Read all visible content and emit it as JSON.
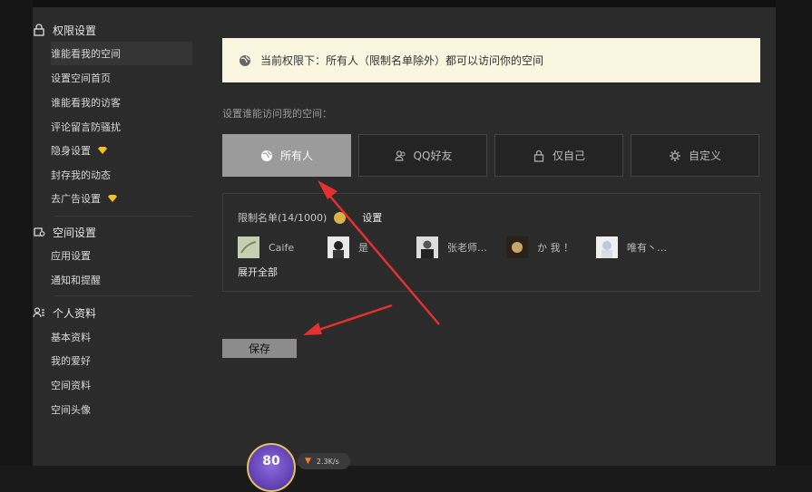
{
  "sidebar": {
    "sections": [
      {
        "title": "权限设置",
        "icon": "lock-icon",
        "items": [
          {
            "label": "谁能看我的空间",
            "active": true
          },
          {
            "label": "设置空间首页"
          },
          {
            "label": "谁能看我的访客"
          },
          {
            "label": "评论留言防骚扰"
          },
          {
            "label": "隐身设置",
            "badge": "diamond-icon"
          },
          {
            "label": "封存我的动态"
          },
          {
            "label": "去广告设置",
            "badge": "diamond-icon"
          }
        ]
      },
      {
        "title": "空间设置",
        "icon": "space-settings-icon",
        "items": [
          {
            "label": "应用设置"
          },
          {
            "label": "通知和提醒"
          }
        ]
      },
      {
        "title": "个人资料",
        "icon": "profile-icon",
        "items": [
          {
            "label": "基本资料"
          },
          {
            "label": "我的爱好"
          },
          {
            "label": "空间资料"
          },
          {
            "label": "空间头像"
          }
        ]
      }
    ]
  },
  "notice": {
    "text": "当前权限下：所有人（限制名单除外）都可以访问你的空间",
    "icon": "globe-icon"
  },
  "access_label": "设置谁能访问我的空间：",
  "tabs": [
    {
      "label": "所有人",
      "icon": "globe-icon",
      "active": true
    },
    {
      "label": "QQ好友",
      "icon": "friends-icon"
    },
    {
      "label": "仅自己",
      "icon": "lock-icon"
    },
    {
      "label": "自定义",
      "icon": "gear-icon"
    }
  ],
  "restrict": {
    "label": "限制名单(14/1000)",
    "set_label": "设置",
    "friends": [
      {
        "name": "Caife"
      },
      {
        "name": "是"
      },
      {
        "name": "张老师…"
      },
      {
        "name": "か 我 ！"
      },
      {
        "name": "唯有丶…"
      }
    ],
    "expand_label": "展开全部"
  },
  "save_label": "保存",
  "status": {
    "level": "80",
    "speed": "2.3K/s"
  },
  "colors": {
    "annotation_arrow": "#e53030",
    "notice_bg": "#fbf6df",
    "active_tab": "#9b9b9b"
  }
}
